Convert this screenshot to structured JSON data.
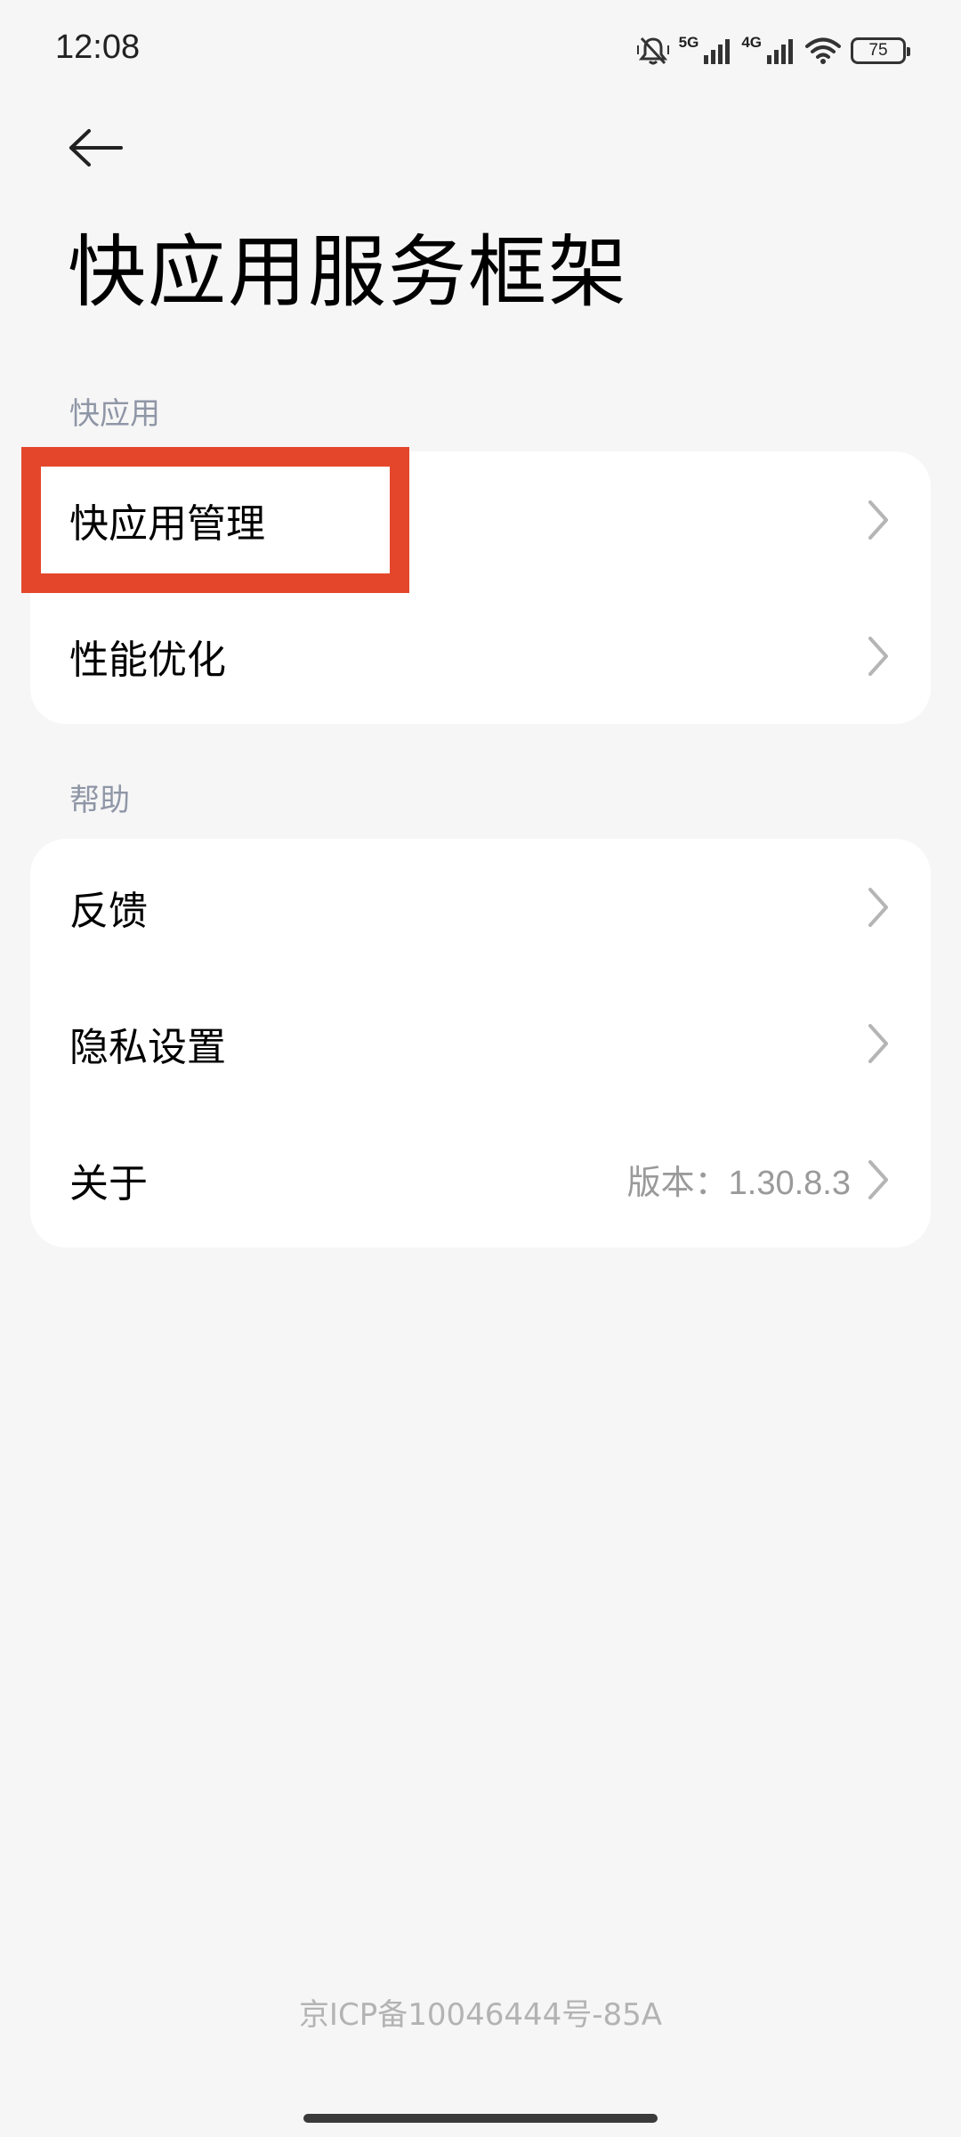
{
  "status_bar": {
    "time": "12:08",
    "network_1": "5G",
    "network_2": "4G",
    "battery": "75",
    "icons": [
      "mute-icon",
      "signal-icon",
      "signal-icon",
      "wifi-icon",
      "battery-icon"
    ]
  },
  "header": {
    "back_icon": "arrow-left-icon",
    "title": "快应用服务框架"
  },
  "sections": [
    {
      "title": "快应用",
      "items": [
        {
          "label": "快应用管理",
          "value": ""
        },
        {
          "label": "性能优化",
          "value": ""
        }
      ]
    },
    {
      "title": "帮助",
      "items": [
        {
          "label": "反馈",
          "value": ""
        },
        {
          "label": "隐私设置",
          "value": ""
        },
        {
          "label": "关于",
          "value": "版本：1.30.8.3"
        }
      ]
    }
  ],
  "highlight": {
    "target": "快应用管理",
    "color": "#e4462b"
  },
  "footer": {
    "icp": "京ICP备10046444号-85A"
  }
}
